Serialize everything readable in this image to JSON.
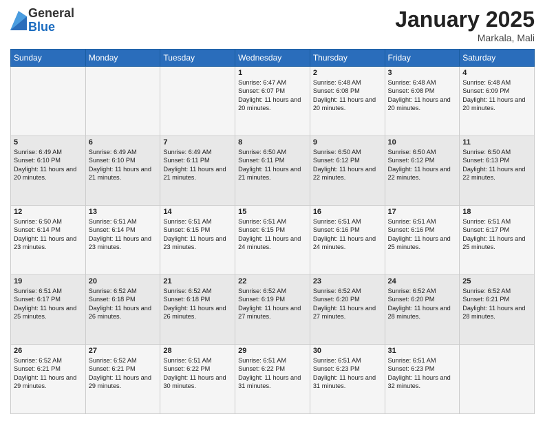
{
  "logo": {
    "general": "General",
    "blue": "Blue"
  },
  "header": {
    "month": "January 2025",
    "location": "Markala, Mali"
  },
  "weekdays": [
    "Sunday",
    "Monday",
    "Tuesday",
    "Wednesday",
    "Thursday",
    "Friday",
    "Saturday"
  ],
  "weeks": [
    [
      {
        "day": "",
        "info": ""
      },
      {
        "day": "",
        "info": ""
      },
      {
        "day": "",
        "info": ""
      },
      {
        "day": "1",
        "info": "Sunrise: 6:47 AM\nSunset: 6:07 PM\nDaylight: 11 hours and 20 minutes."
      },
      {
        "day": "2",
        "info": "Sunrise: 6:48 AM\nSunset: 6:08 PM\nDaylight: 11 hours and 20 minutes."
      },
      {
        "day": "3",
        "info": "Sunrise: 6:48 AM\nSunset: 6:08 PM\nDaylight: 11 hours and 20 minutes."
      },
      {
        "day": "4",
        "info": "Sunrise: 6:48 AM\nSunset: 6:09 PM\nDaylight: 11 hours and 20 minutes."
      }
    ],
    [
      {
        "day": "5",
        "info": "Sunrise: 6:49 AM\nSunset: 6:10 PM\nDaylight: 11 hours and 20 minutes."
      },
      {
        "day": "6",
        "info": "Sunrise: 6:49 AM\nSunset: 6:10 PM\nDaylight: 11 hours and 21 minutes."
      },
      {
        "day": "7",
        "info": "Sunrise: 6:49 AM\nSunset: 6:11 PM\nDaylight: 11 hours and 21 minutes."
      },
      {
        "day": "8",
        "info": "Sunrise: 6:50 AM\nSunset: 6:11 PM\nDaylight: 11 hours and 21 minutes."
      },
      {
        "day": "9",
        "info": "Sunrise: 6:50 AM\nSunset: 6:12 PM\nDaylight: 11 hours and 22 minutes."
      },
      {
        "day": "10",
        "info": "Sunrise: 6:50 AM\nSunset: 6:12 PM\nDaylight: 11 hours and 22 minutes."
      },
      {
        "day": "11",
        "info": "Sunrise: 6:50 AM\nSunset: 6:13 PM\nDaylight: 11 hours and 22 minutes."
      }
    ],
    [
      {
        "day": "12",
        "info": "Sunrise: 6:50 AM\nSunset: 6:14 PM\nDaylight: 11 hours and 23 minutes."
      },
      {
        "day": "13",
        "info": "Sunrise: 6:51 AM\nSunset: 6:14 PM\nDaylight: 11 hours and 23 minutes."
      },
      {
        "day": "14",
        "info": "Sunrise: 6:51 AM\nSunset: 6:15 PM\nDaylight: 11 hours and 23 minutes."
      },
      {
        "day": "15",
        "info": "Sunrise: 6:51 AM\nSunset: 6:15 PM\nDaylight: 11 hours and 24 minutes."
      },
      {
        "day": "16",
        "info": "Sunrise: 6:51 AM\nSunset: 6:16 PM\nDaylight: 11 hours and 24 minutes."
      },
      {
        "day": "17",
        "info": "Sunrise: 6:51 AM\nSunset: 6:16 PM\nDaylight: 11 hours and 25 minutes."
      },
      {
        "day": "18",
        "info": "Sunrise: 6:51 AM\nSunset: 6:17 PM\nDaylight: 11 hours and 25 minutes."
      }
    ],
    [
      {
        "day": "19",
        "info": "Sunrise: 6:51 AM\nSunset: 6:17 PM\nDaylight: 11 hours and 25 minutes."
      },
      {
        "day": "20",
        "info": "Sunrise: 6:52 AM\nSunset: 6:18 PM\nDaylight: 11 hours and 26 minutes."
      },
      {
        "day": "21",
        "info": "Sunrise: 6:52 AM\nSunset: 6:18 PM\nDaylight: 11 hours and 26 minutes."
      },
      {
        "day": "22",
        "info": "Sunrise: 6:52 AM\nSunset: 6:19 PM\nDaylight: 11 hours and 27 minutes."
      },
      {
        "day": "23",
        "info": "Sunrise: 6:52 AM\nSunset: 6:20 PM\nDaylight: 11 hours and 27 minutes."
      },
      {
        "day": "24",
        "info": "Sunrise: 6:52 AM\nSunset: 6:20 PM\nDaylight: 11 hours and 28 minutes."
      },
      {
        "day": "25",
        "info": "Sunrise: 6:52 AM\nSunset: 6:21 PM\nDaylight: 11 hours and 28 minutes."
      }
    ],
    [
      {
        "day": "26",
        "info": "Sunrise: 6:52 AM\nSunset: 6:21 PM\nDaylight: 11 hours and 29 minutes."
      },
      {
        "day": "27",
        "info": "Sunrise: 6:52 AM\nSunset: 6:21 PM\nDaylight: 11 hours and 29 minutes."
      },
      {
        "day": "28",
        "info": "Sunrise: 6:51 AM\nSunset: 6:22 PM\nDaylight: 11 hours and 30 minutes."
      },
      {
        "day": "29",
        "info": "Sunrise: 6:51 AM\nSunset: 6:22 PM\nDaylight: 11 hours and 31 minutes."
      },
      {
        "day": "30",
        "info": "Sunrise: 6:51 AM\nSunset: 6:23 PM\nDaylight: 11 hours and 31 minutes."
      },
      {
        "day": "31",
        "info": "Sunrise: 6:51 AM\nSunset: 6:23 PM\nDaylight: 11 hours and 32 minutes."
      },
      {
        "day": "",
        "info": ""
      }
    ]
  ]
}
